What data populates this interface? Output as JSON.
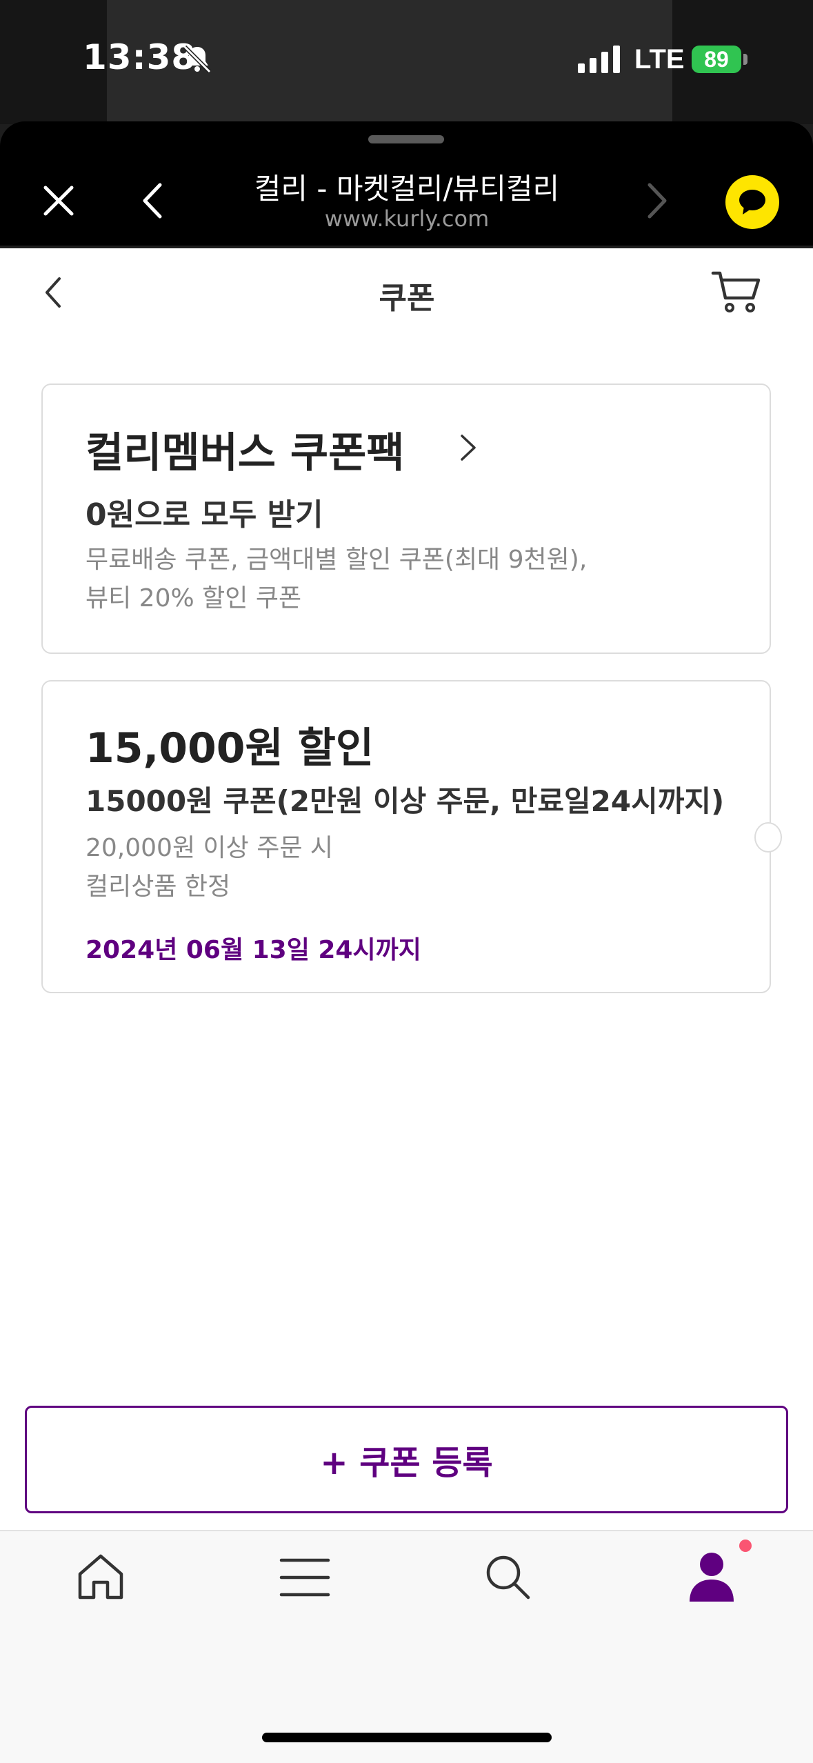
{
  "status_bar": {
    "time": "13:38",
    "network": "LTE",
    "battery": "89",
    "icons": [
      "bell-slash-icon",
      "signal-icon",
      "battery-icon"
    ]
  },
  "browser": {
    "title": "컬리 - 마켓컬리/뷰티컬리",
    "url": "www.kurly.com",
    "icons": [
      "close-icon",
      "back-icon",
      "forward-icon",
      "kakao-chat-icon"
    ],
    "accent_color": "#fee500"
  },
  "page": {
    "title": "쿠폰",
    "icons": [
      "back-icon",
      "cart-icon"
    ]
  },
  "member_pack": {
    "title": "컬리멤버스 쿠폰팩",
    "subtitle": "0원으로 모두 받기",
    "desc_line1": "무료배송 쿠폰, 금액대별 할인 쿠폰(최대 9천원),",
    "desc_line2": "뷰티 20% 할인 쿠폰"
  },
  "coupons": [
    {
      "amount": "15,000원 할인",
      "name": "15000원 쿠폰(2만원 이상 주문, 만료일24시까지)",
      "condition1": "20,000원 이상 주문 시",
      "condition2": "컬리상품 한정",
      "expiry": "2024년 06월 13일 24시까지"
    }
  ],
  "register_button": {
    "label": "+ 쿠폰 등록"
  },
  "tabbar": {
    "items": [
      "home-icon",
      "category-menu-icon",
      "search-icon",
      "my-kurly-icon"
    ],
    "active": "my-kurly-icon"
  },
  "colors": {
    "brand_purple": "#5f0080",
    "notification_dot": "#fa5572",
    "battery_green": "#30c451"
  }
}
